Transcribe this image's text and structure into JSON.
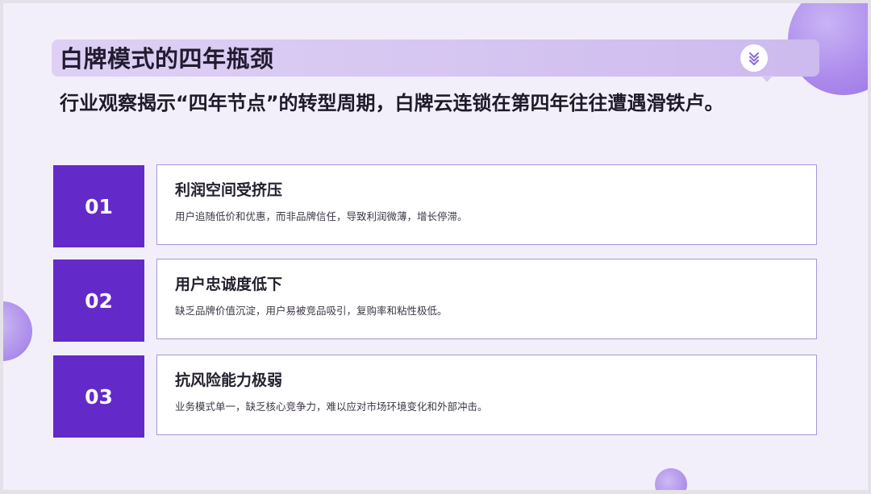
{
  "slide": {
    "title": "白牌模式的四年瓶颈",
    "subtitle": "行业观察揭示“四年节点”的转型周期，白牌云连锁在第四年往往遭遇滑铁卢。",
    "badge_icon": "double-chevron-down-icon"
  },
  "items": [
    {
      "number": "01",
      "title": "利润空间受挤压",
      "desc": "用户追随低价和优惠，而非品牌信任，导致利润微薄，增长停滞。"
    },
    {
      "number": "02",
      "title": "用户忠诚度低下",
      "desc": "缺乏品牌价值沉淀，用户易被竞品吸引，复购率和粘性极低。"
    },
    {
      "number": "03",
      "title": "抗风险能力极弱",
      "desc": "业务模式单一，缺乏核心竞争力，难以应对市场环境变化和外部冲击。"
    }
  ],
  "colors": {
    "accent": "#6429c9",
    "background": "#f3effa",
    "title_band": "#d8c9f2",
    "card_border": "#a796d8"
  }
}
